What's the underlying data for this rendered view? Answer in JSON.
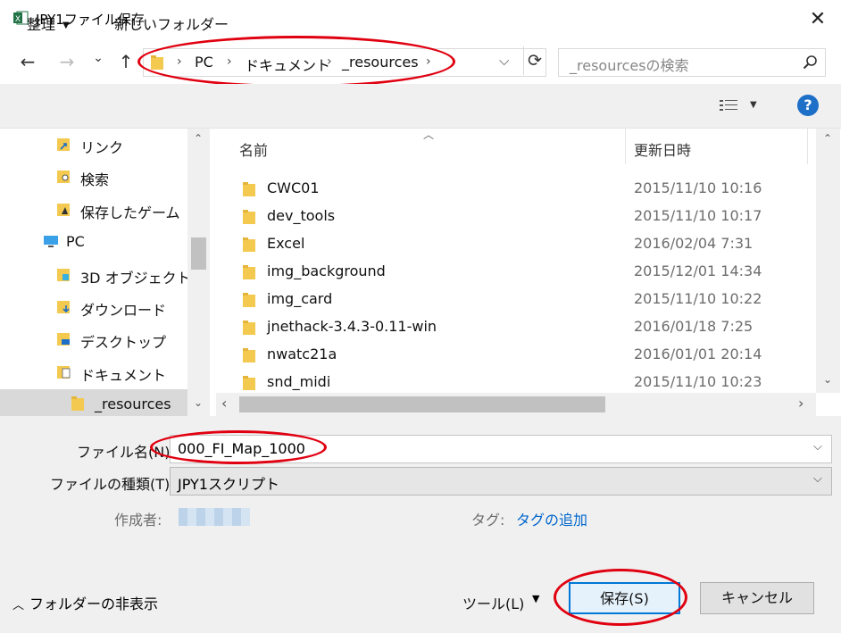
{
  "window": {
    "title": "JPY1ファイル保存",
    "close_glyph": "✕"
  },
  "nav": {
    "back": "←",
    "forward": "→",
    "recent": "⌄",
    "up": "↑",
    "breadcrumb": [
      "PC",
      "ドキュメント",
      "_resources"
    ],
    "search_placeholder": "_resourcesの検索"
  },
  "toolbar": {
    "organize": "整理",
    "new_folder": "新しいフォルダー",
    "help": "?"
  },
  "sidebar": {
    "items": [
      {
        "label": "リンク",
        "icon": "link-folder-icon"
      },
      {
        "label": "検索",
        "icon": "search-folder-icon"
      },
      {
        "label": "保存したゲーム",
        "icon": "saved-games-icon"
      },
      {
        "label": "PC",
        "icon": "pc-icon"
      },
      {
        "label": "3D オブジェクト",
        "icon": "3d-objects-icon"
      },
      {
        "label": "ダウンロード",
        "icon": "downloads-icon"
      },
      {
        "label": "デスクトップ",
        "icon": "desktop-icon"
      },
      {
        "label": "ドキュメント",
        "icon": "documents-icon"
      },
      {
        "label": "_resources",
        "icon": "folder-icon"
      }
    ],
    "selected": "_resources"
  },
  "file_list": {
    "columns": [
      "名前",
      "更新日時"
    ],
    "rows": [
      {
        "name": "CWC01",
        "date": "2015/11/10 10:16"
      },
      {
        "name": "dev_tools",
        "date": "2015/11/10 10:17"
      },
      {
        "name": "Excel",
        "date": "2016/02/04 7:31"
      },
      {
        "name": "img_background",
        "date": "2015/12/01 14:34"
      },
      {
        "name": "img_card",
        "date": "2015/11/10 10:22"
      },
      {
        "name": "jnethack-3.4.3-0.11-win",
        "date": "2016/01/18 7:25"
      },
      {
        "name": "nwatc21a",
        "date": "2016/01/01 20:14"
      },
      {
        "name": "snd_midi",
        "date": "2015/11/10 10:23"
      }
    ]
  },
  "form": {
    "filename_label": "ファイル名(N):",
    "filename_value": "000_FI_Map_1000",
    "filetype_label": "ファイルの種類(T):",
    "filetype_value": "JPY1スクリプト",
    "author_label": "作成者:",
    "tags_label": "タグ:",
    "tags_link": "タグの追加"
  },
  "footer": {
    "hide_folders": "フォルダーの非表示",
    "tools": "ツール(L)",
    "save": "保存(S)",
    "cancel": "キャンセル"
  },
  "colors": {
    "accent": "#0066cc",
    "highlight": "#e00010",
    "selected_bg": "#cce8ff"
  }
}
